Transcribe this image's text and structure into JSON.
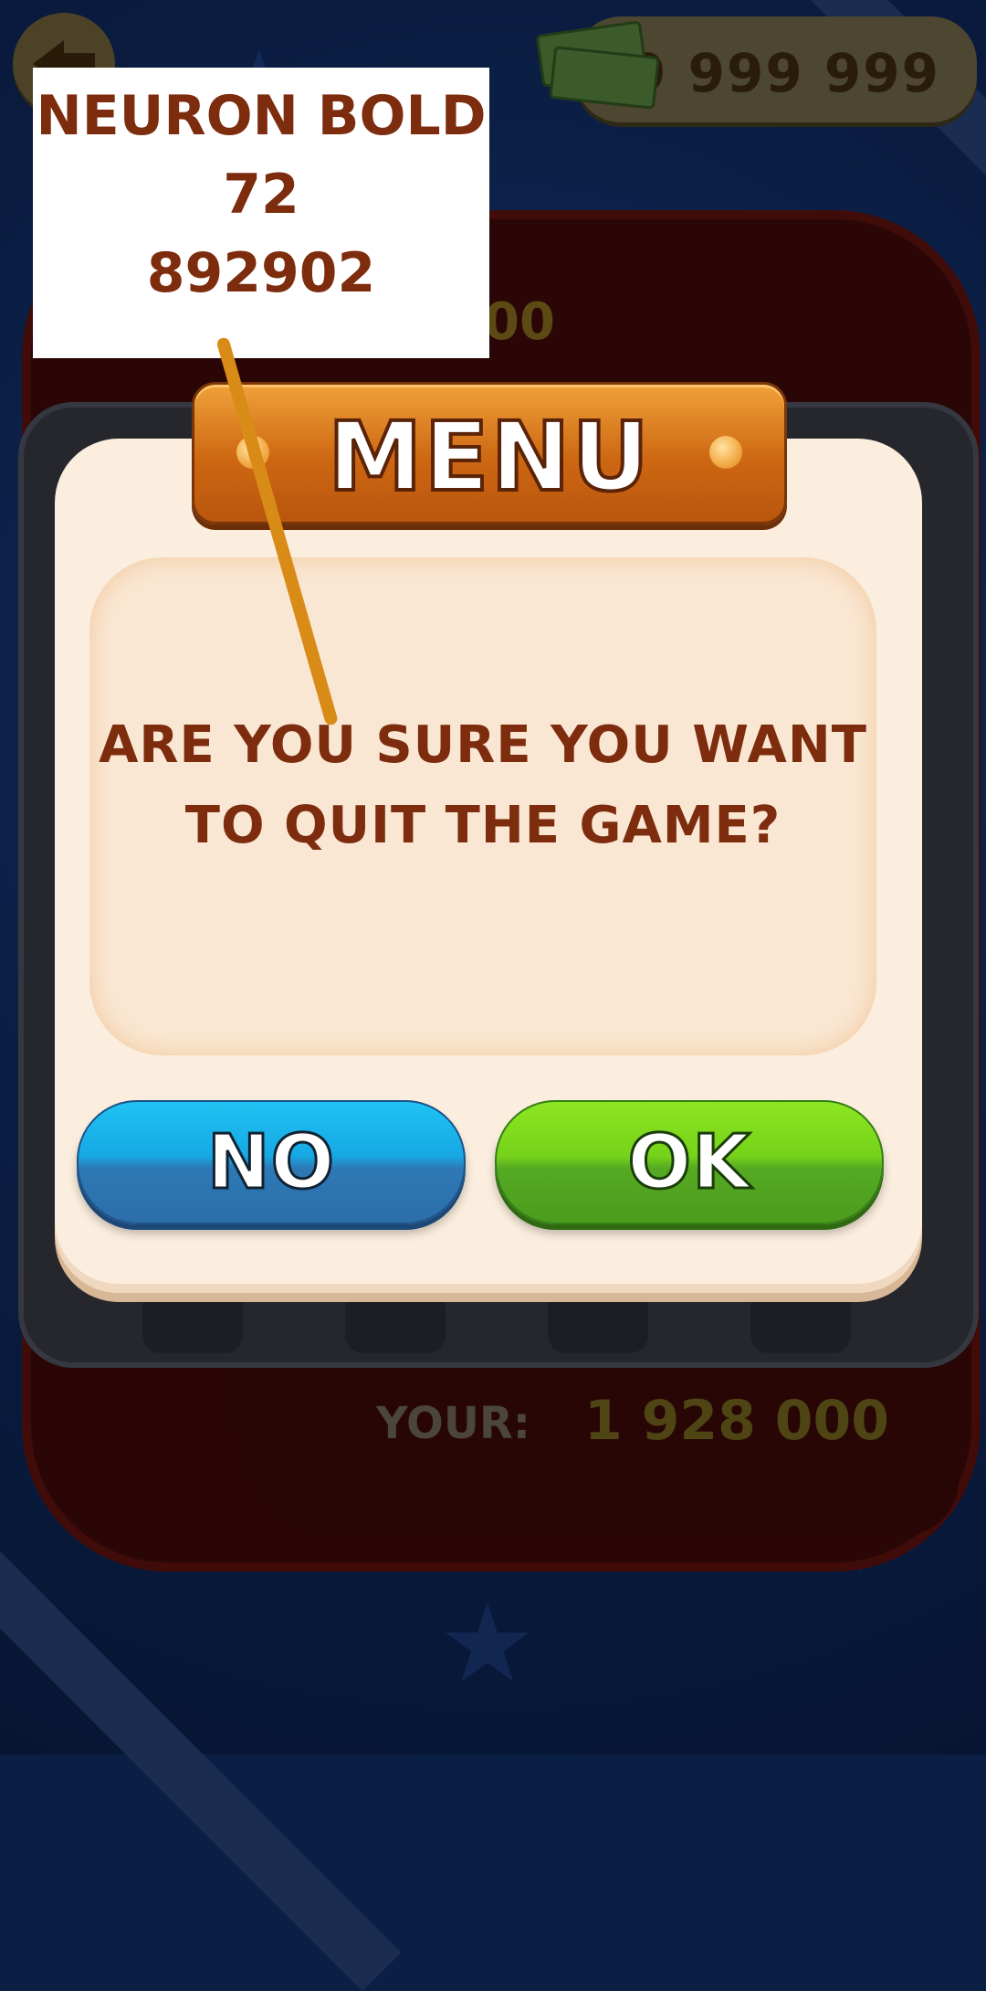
{
  "header": {
    "cash": "9 999 999",
    "back_icon": "back-arrow-icon",
    "money_icon": "cash-stack-icon"
  },
  "board": {
    "top_value_partial": "00",
    "your_label": "YOUR:",
    "your_value": "1 928 000"
  },
  "dialog": {
    "title": "MENU",
    "message_line1": "ARE YOU SURE YOU WANT",
    "message_line2": "TO QUIT THE GAME?",
    "no_label": "NO",
    "ok_label": "OK"
  },
  "annotation": {
    "font_name": "NEURON BOLD",
    "font_size": "72",
    "color_code": "892902"
  },
  "colors": {
    "text_brown": "#892902",
    "no_button": "#17a8e4",
    "ok_button": "#76d21a",
    "banner": "#cd6712"
  }
}
